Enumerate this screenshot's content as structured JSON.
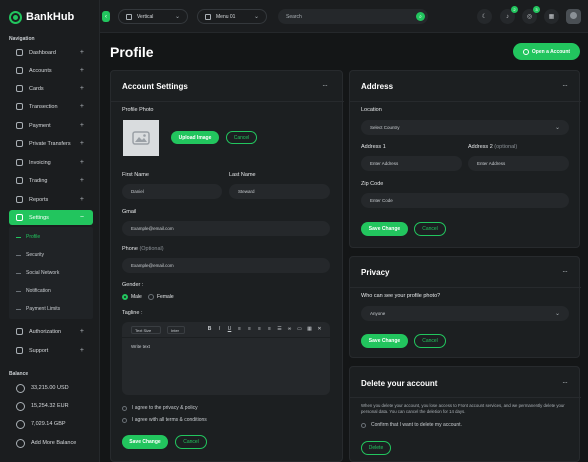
{
  "brand": {
    "name": "BankHub"
  },
  "sidebar": {
    "nav_heading": "Navigation",
    "items": [
      {
        "label": "Dashboard",
        "icon": "home-icon"
      },
      {
        "label": "Accounts",
        "icon": "accounts-icon"
      },
      {
        "label": "Cards",
        "icon": "card-icon"
      },
      {
        "label": "Transection",
        "icon": "transfer-icon"
      },
      {
        "label": "Payment",
        "icon": "wallet-icon"
      },
      {
        "label": "Private Transfers",
        "icon": "private-transfer-icon"
      },
      {
        "label": "Invoicing",
        "icon": "invoice-icon"
      },
      {
        "label": "Trading",
        "icon": "trading-icon"
      },
      {
        "label": "Reports",
        "icon": "reports-icon"
      },
      {
        "label": "Settings",
        "icon": "settings-icon",
        "active": true
      },
      {
        "label": "Authorization",
        "icon": "authorization-icon"
      },
      {
        "label": "Support",
        "icon": "support-icon"
      }
    ],
    "settings_sub": [
      {
        "label": "Profile",
        "active": true
      },
      {
        "label": "Security"
      },
      {
        "label": "Social Network"
      },
      {
        "label": "Notification"
      },
      {
        "label": "Payment Limits"
      }
    ],
    "balance_heading": "Balance",
    "balances": [
      {
        "label": "33,215.00 USD",
        "icon": "dollar-icon"
      },
      {
        "label": "15,254.32 EUR",
        "icon": "euro-icon"
      },
      {
        "label": "7,029.14 GBP",
        "icon": "pound-icon"
      },
      {
        "label": "Add More Balance",
        "icon": "add-circle-icon"
      }
    ]
  },
  "topbar": {
    "layout_select": "Vertical",
    "menu_select": "Menu 01",
    "search_placeholder": "Search",
    "notif_count_1": "2",
    "notif_count_2": "3"
  },
  "page": {
    "title": "Profile",
    "open_account_label": "Open a Account"
  },
  "account_settings": {
    "title": "Account Settings",
    "photo_label": "Profile Photo",
    "upload_label": "Upload Image",
    "cancel_label": "Cancel",
    "first_name_label": "First Name",
    "first_name_value": "Daniel",
    "last_name_label": "Last Name",
    "last_name_value": "Steward",
    "gmail_label": "Gmail",
    "gmail_value": "Example@email.com",
    "phone_label": "Phone",
    "phone_optional": "(Optional)",
    "phone_value": "Example@email.com",
    "gender_label": "Gender :",
    "gender_male": "Male",
    "gender_female": "Female",
    "tagline_label": "Tagline :",
    "text_size": "Text Size",
    "inter": "Inter",
    "editor_text": "Write text",
    "agree_privacy": "I agree to the privacy & policy",
    "agree_terms": "I agree with all terms & conditions",
    "save_label": "Save Change",
    "cancel2_label": "Cancel"
  },
  "address": {
    "title": "Address",
    "location_label": "Location",
    "country_placeholder": "Select Country",
    "address1_label": "Address 1",
    "address1_placeholder": "Enter Address",
    "address2_label": "Address 2",
    "address2_optional": "(optional)",
    "address2_placeholder": "Enter Address",
    "zip_label": "Zip Code",
    "zip_placeholder": "Enter Code",
    "save_label": "Save Change",
    "cancel_label": "Cancel"
  },
  "privacy": {
    "title": "Privacy",
    "question": "Who can see your profile photo?",
    "selected": "Anyone",
    "save_label": "Save Change",
    "cancel_label": "Cancel"
  },
  "delete_account": {
    "title": "Delete your account",
    "description": "When you delete your account, you lose access to Front account services, and we permanently delete your personal data. You can cancel the deletion for 14 days.",
    "confirm_label": "Confirm that I want to delete my account.",
    "delete_label": "Delete"
  },
  "colors": {
    "accent": "#22c55e",
    "background": "#141617",
    "card": "#1c1f21"
  }
}
